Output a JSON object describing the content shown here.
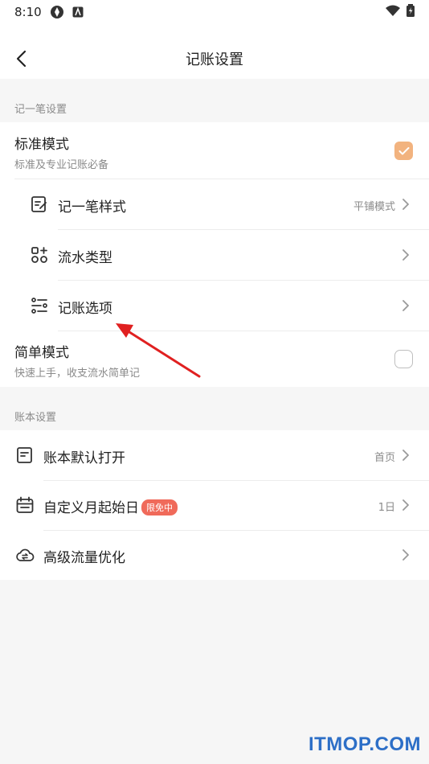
{
  "status_bar": {
    "time": "8:10"
  },
  "header": {
    "title": "记账设置"
  },
  "sections": {
    "record": {
      "label": "记一笔设置",
      "standard": {
        "title": "标准模式",
        "subtitle": "标准及专业记账必备",
        "checked": true
      },
      "sub_items": [
        {
          "label": "记一笔样式",
          "value": "平铺模式",
          "icon": "edit-note-icon"
        },
        {
          "label": "流水类型",
          "value": "",
          "icon": "grid-apps-icon"
        },
        {
          "label": "记账选项",
          "value": "",
          "icon": "sliders-icon"
        }
      ],
      "simple": {
        "title": "简单模式",
        "subtitle": "快速上手，收支流水简单记",
        "checked": false
      }
    },
    "ledger": {
      "label": "账本设置",
      "items": [
        {
          "label": "账本默认打开",
          "value": "首页",
          "badge": "",
          "icon": "document-icon"
        },
        {
          "label": "自定义月起始日",
          "value": "1日",
          "badge": "限免中",
          "icon": "calendar-icon"
        },
        {
          "label": "高级流量优化",
          "value": "",
          "badge": "",
          "icon": "cloud-sync-icon"
        }
      ]
    }
  },
  "watermark": "ITMOP.COM",
  "colors": {
    "accent": "#f2b37f",
    "badge": "#f06a5a",
    "annotation_arrow": "#e02020"
  }
}
